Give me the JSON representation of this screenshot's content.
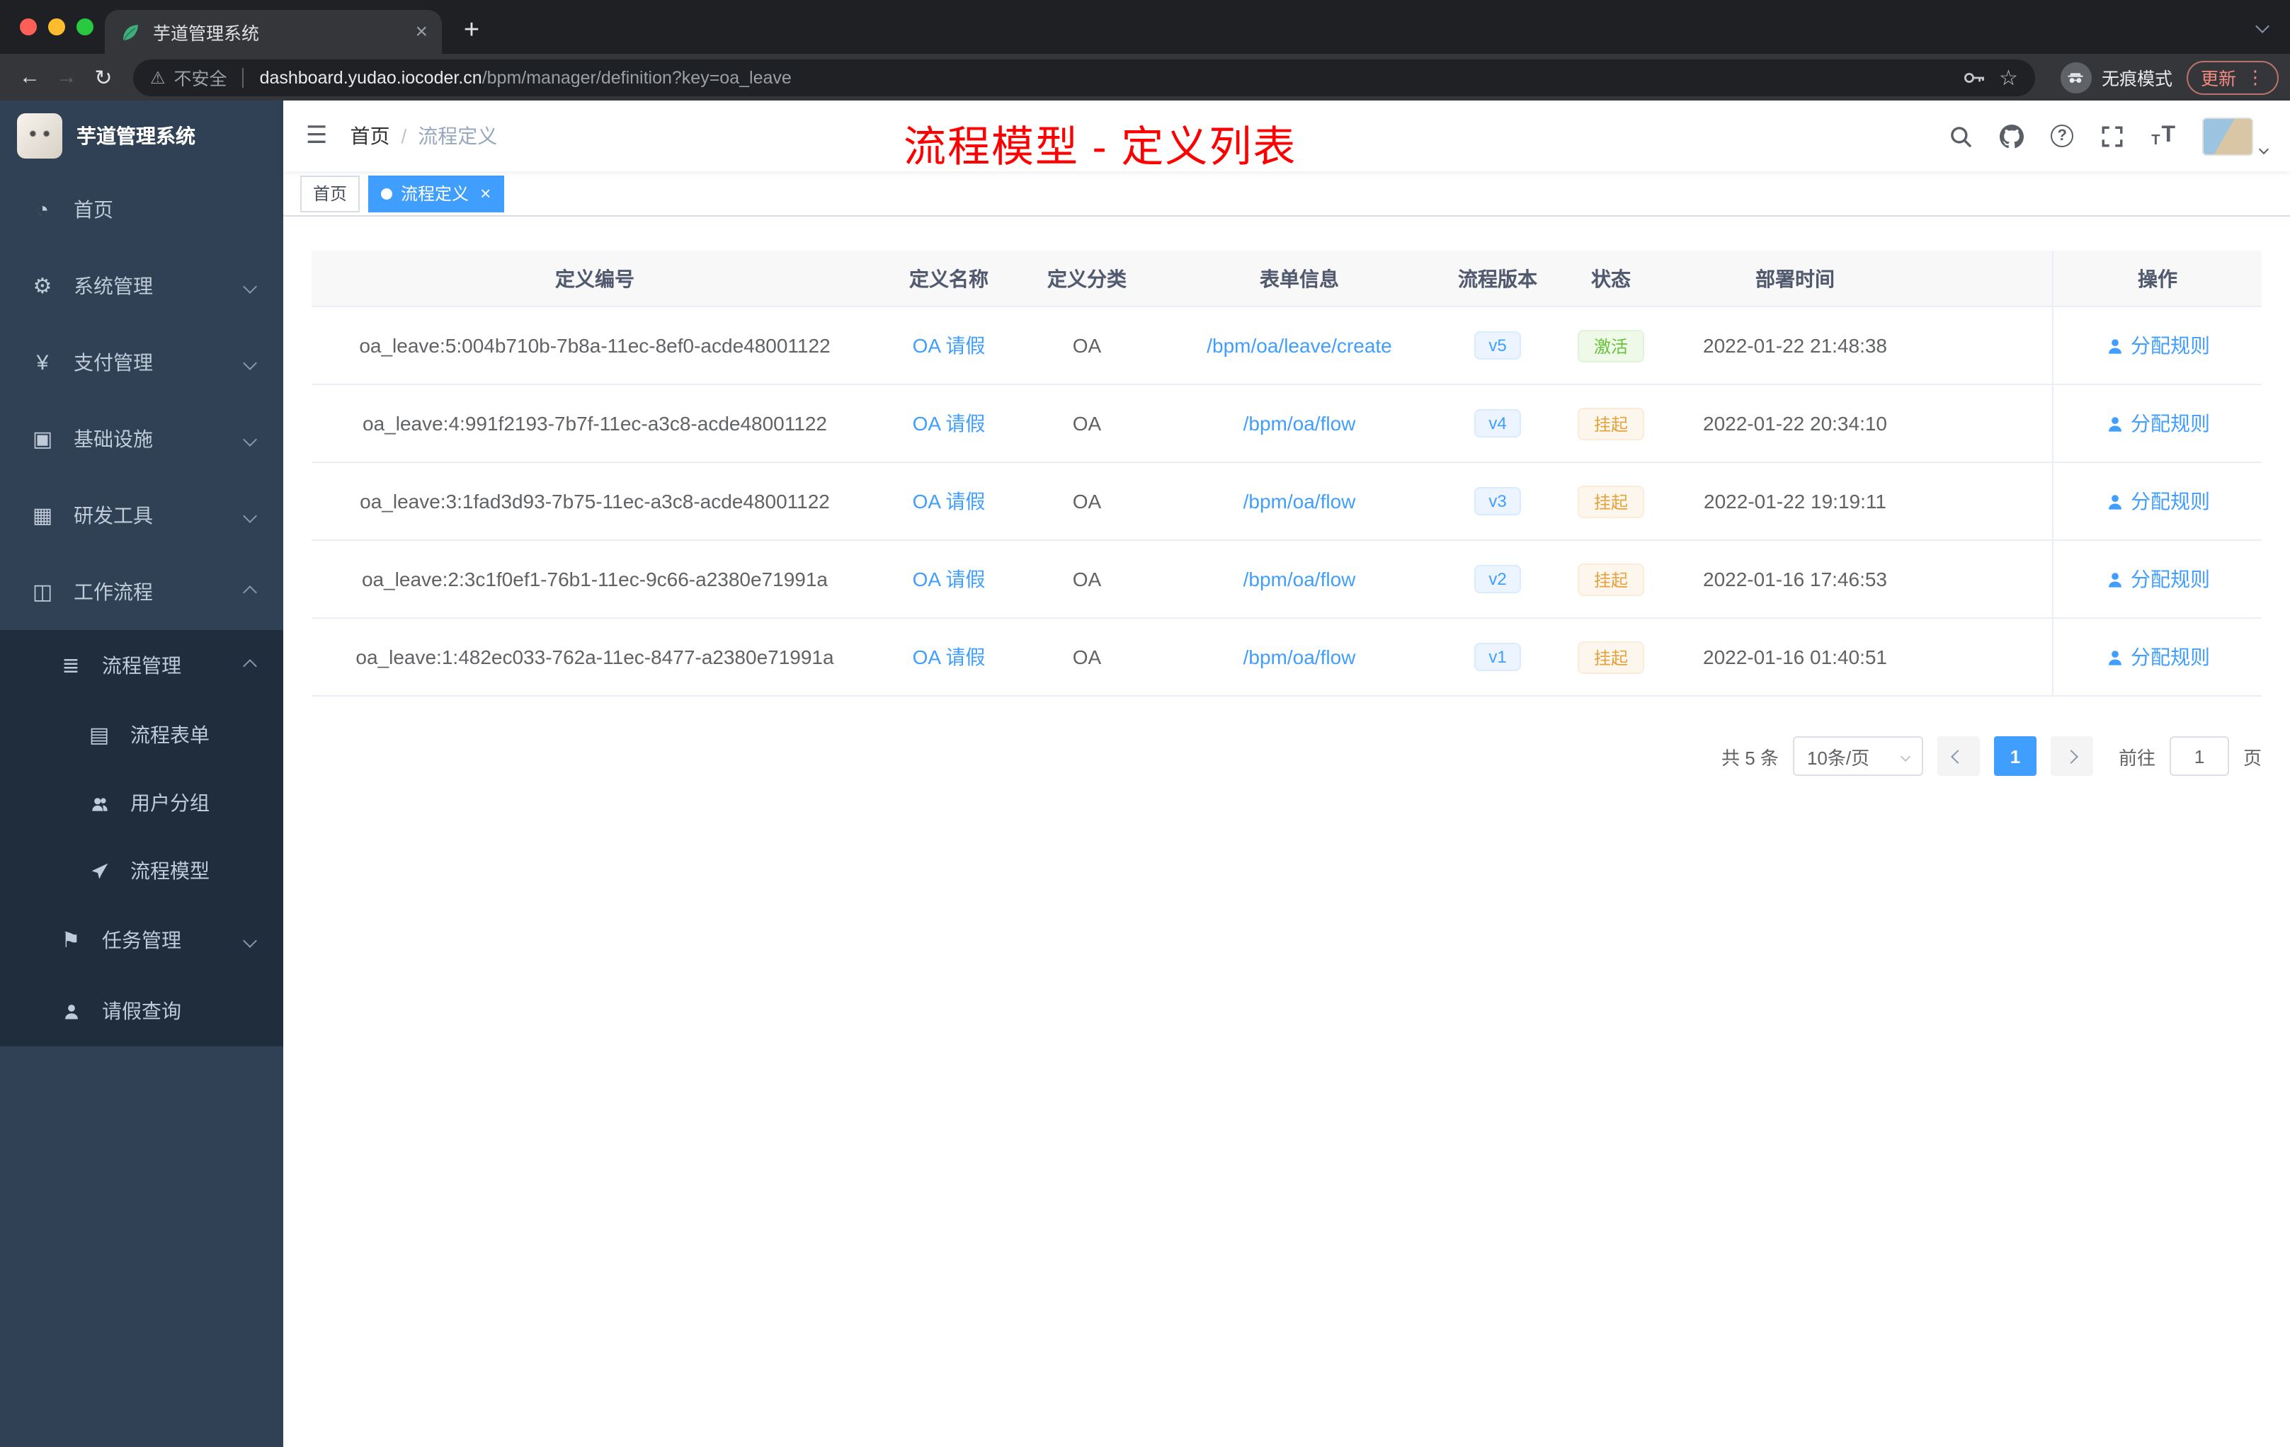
{
  "colors": {
    "accent": "#409eff",
    "success": "#67c23a",
    "warning": "#e6a23c",
    "annotation_red": "#ff0000",
    "sidebar_bg": "#304156",
    "sidebar_sub_bg": "#1f2d3d",
    "chrome_dark": "#202124"
  },
  "browser": {
    "tab_title": "芋道管理系统",
    "security": "不安全",
    "url_domain": "dashboard.yudao.iocoder.cn",
    "url_path": "/bpm/manager/definition?key=oa_leave",
    "incognito": "无痕模式",
    "update": "更新"
  },
  "sidebar": {
    "brand": "芋道管理系统",
    "items": [
      {
        "label": "首页",
        "icon": "dashboard-icon"
      },
      {
        "label": "系统管理",
        "icon": "gear-icon"
      },
      {
        "label": "支付管理",
        "icon": "yen-icon"
      },
      {
        "label": "基础设施",
        "icon": "monitor-icon"
      },
      {
        "label": "研发工具",
        "icon": "toolbox-icon"
      },
      {
        "label": "工作流程",
        "icon": "briefcase-icon"
      }
    ],
    "workflow_children": [
      {
        "label": "流程管理",
        "icon": "list-icon"
      },
      {
        "label": "流程表单",
        "icon": "document-icon"
      },
      {
        "label": "用户分组",
        "icon": "people-icon"
      },
      {
        "label": "流程模型",
        "icon": "paper-plane-icon"
      },
      {
        "label": "任务管理",
        "icon": "flag-icon"
      },
      {
        "label": "请假查询",
        "icon": "person-icon"
      }
    ]
  },
  "header": {
    "breadcrumb_home": "首页",
    "breadcrumb_current": "流程定义",
    "annotation": "流程模型 - 定义列表"
  },
  "tags": {
    "home": "首页",
    "active": "流程定义"
  },
  "table": {
    "columns": {
      "id": "定义编号",
      "name": "定义名称",
      "category": "定义分类",
      "form": "表单信息",
      "version": "流程版本",
      "status": "状态",
      "time": "部署时间",
      "action": "操作"
    },
    "rows": [
      {
        "id": "oa_leave:5:004b710b-7b8a-11ec-8ef0-acde48001122",
        "name": "OA 请假",
        "category": "OA",
        "form": "/bpm/oa/leave/create",
        "version": "v5",
        "status": "激活",
        "time": "2022-01-22 21:48:38",
        "action": "分配规则"
      },
      {
        "id": "oa_leave:4:991f2193-7b7f-11ec-a3c8-acde48001122",
        "name": "OA 请假",
        "category": "OA",
        "form": "/bpm/oa/flow",
        "version": "v4",
        "status": "挂起",
        "time": "2022-01-22 20:34:10",
        "action": "分配规则"
      },
      {
        "id": "oa_leave:3:1fad3d93-7b75-11ec-a3c8-acde48001122",
        "name": "OA 请假",
        "category": "OA",
        "form": "/bpm/oa/flow",
        "version": "v3",
        "status": "挂起",
        "time": "2022-01-22 19:19:11",
        "action": "分配规则"
      },
      {
        "id": "oa_leave:2:3c1f0ef1-76b1-11ec-9c66-a2380e71991a",
        "name": "OA 请假",
        "category": "OA",
        "form": "/bpm/oa/flow",
        "version": "v2",
        "status": "挂起",
        "time": "2022-01-16 17:46:53",
        "action": "分配规则"
      },
      {
        "id": "oa_leave:1:482ec033-762a-11ec-8477-a2380e71991a",
        "name": "OA 请假",
        "category": "OA",
        "form": "/bpm/oa/flow",
        "version": "v1",
        "status": "挂起",
        "time": "2022-01-16 01:40:51",
        "action": "分配规则"
      }
    ]
  },
  "pagination": {
    "total": "共 5 条",
    "page_size": "10条/页",
    "page": "1",
    "goto": "前往",
    "goto_value": "1",
    "unit": "页"
  }
}
